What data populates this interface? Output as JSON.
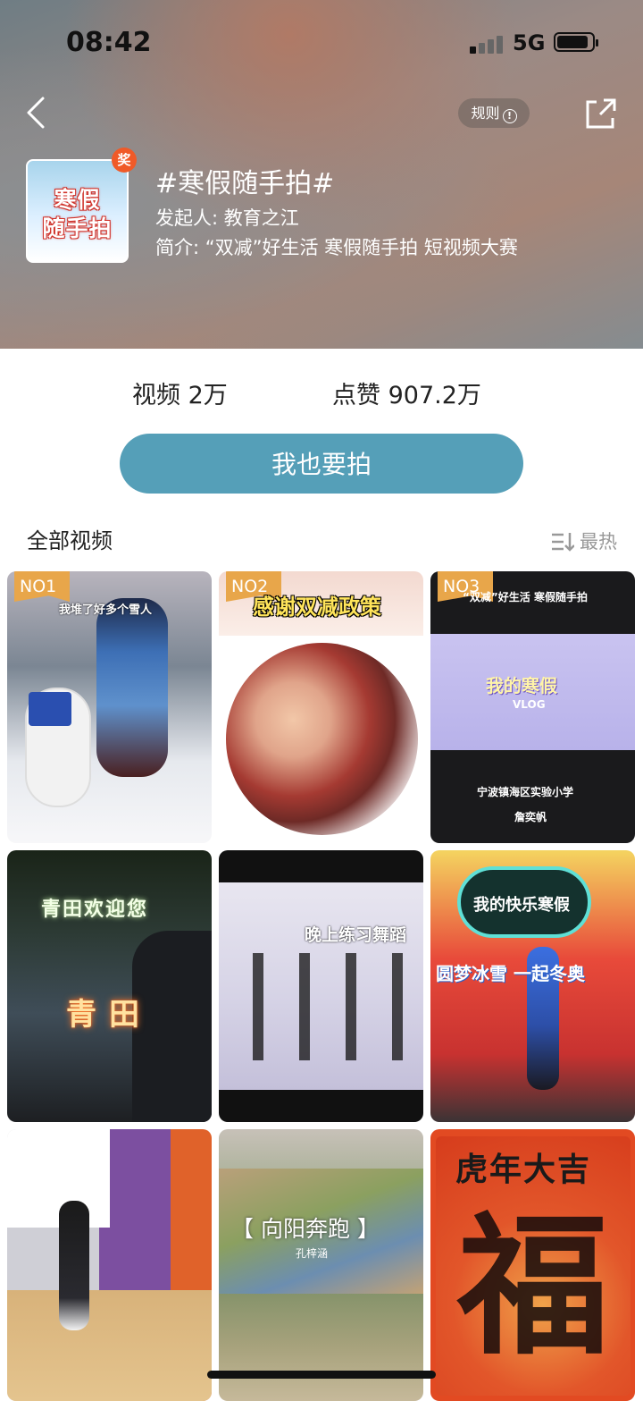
{
  "status_bar": {
    "time": "08:42",
    "network": "5G"
  },
  "header": {
    "rules_label": "规则",
    "topic_title": "#寒假随手拍#",
    "initiator": "发起人: 教育之江",
    "intro": "简介: “双减”好生活 寒假随手拍 短视频大赛",
    "cover": {
      "line1": "寒假",
      "line2": "随手拍",
      "badge": "奖"
    }
  },
  "stats": {
    "videos": "视频 2万",
    "likes": "点赞 907.2万"
  },
  "cta_label": "我也要拍",
  "section": {
    "title": "全部视频",
    "sort_label": "最热"
  },
  "videos": [
    {
      "rank": "NO1",
      "caption": "我堆了好多个雪人"
    },
    {
      "rank": "NO2",
      "caption": "感谢双减政策"
    },
    {
      "rank": "NO3",
      "caption_top": "“双减”好生活 寒假随手拍",
      "caption_mid": "我的寒假",
      "vlog": "VLOG",
      "school": "宁波镇海区实验小学",
      "name": "詹奕帆"
    },
    {
      "caption_top": "青田欢迎您",
      "caption_mid": "青田"
    },
    {
      "caption": "晚上练习舞蹈"
    },
    {
      "caption": "我的快乐寒假",
      "banner": "圆梦冰雪 一起冬奥"
    },
    {
      "caption": ""
    },
    {
      "caption": "【 向阳奔跑 】",
      "sub": "孔梓涵"
    },
    {
      "caption": "虎年大吉",
      "big": "福"
    }
  ],
  "colors": {
    "accent": "#559fb8",
    "rank_badge": "#e8a64a",
    "award_badge": "#f05a28"
  }
}
